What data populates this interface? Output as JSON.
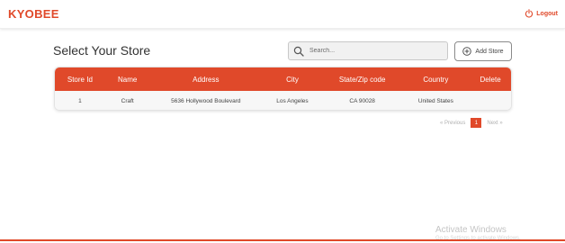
{
  "header": {
    "logo": "KYOBEE",
    "logout_label": "Logout"
  },
  "main": {
    "title": "Select Your Store",
    "search_placeholder": "Search...",
    "add_store_label": "Add Store"
  },
  "table": {
    "columns": [
      "Store Id",
      "Name",
      "Address",
      "City",
      "State/Zip code",
      "Country",
      "Delete"
    ],
    "rows": [
      [
        "1",
        "Craft",
        "5636 Hollywood Boulevard",
        "Los Angeles",
        "CA 90028",
        "United States",
        ""
      ]
    ]
  },
  "pagination": {
    "previous_label": "« Previous",
    "current_page": "1",
    "next_label": "Next »"
  },
  "watermark": {
    "title": "Activate Windows",
    "subtitle": "Go to Settings to activate Windows."
  },
  "colors": {
    "accent": "#e0492a"
  }
}
